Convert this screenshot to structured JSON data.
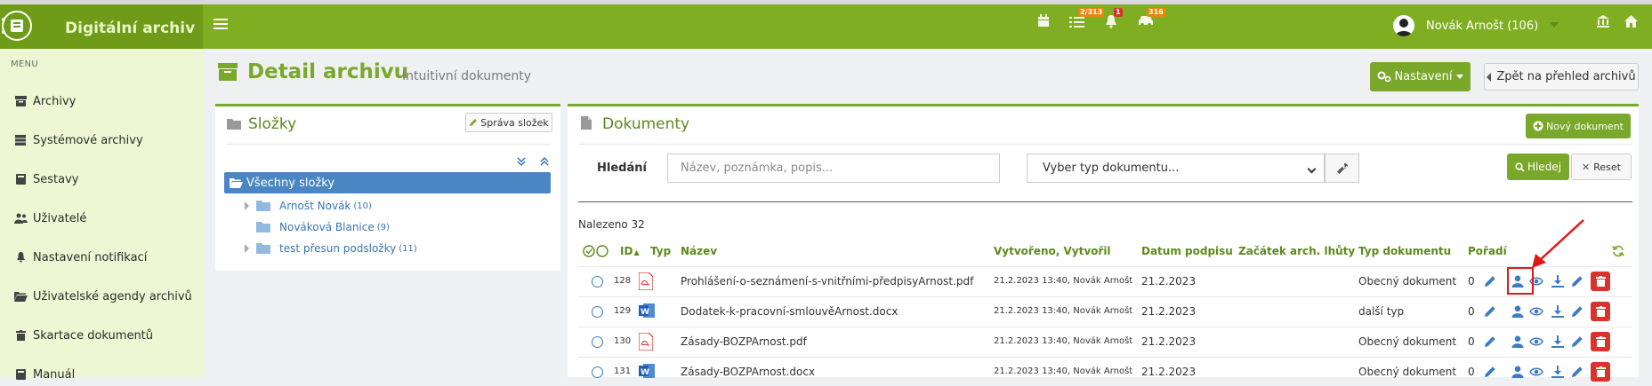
{
  "app": {
    "title": "Digitální archiv"
  },
  "topbar": {
    "badges": {
      "tasks": "2/313",
      "notifications": "1",
      "transfers": "316"
    },
    "user_name": "Novák Arnošt (106)"
  },
  "sidebar": {
    "menu_label": "MENU",
    "items": [
      {
        "label": "Archivy",
        "icon": "archive-icon"
      },
      {
        "label": "Systémové archivy",
        "icon": "server-icon"
      },
      {
        "label": "Sestavy",
        "icon": "book-icon"
      },
      {
        "label": "Uživatelé",
        "icon": "users-icon"
      },
      {
        "label": "Nastavení notifikací",
        "icon": "bell-icon"
      },
      {
        "label": "Uživatelské agendy archivů",
        "icon": "folder-open-icon"
      },
      {
        "label": "Skartace dokumentů",
        "icon": "trash-icon"
      },
      {
        "label": "Manuál",
        "icon": "book-icon"
      }
    ]
  },
  "page": {
    "title": "Detail archivu",
    "subtitle": "Intuitivní dokumenty",
    "settings_label": "Nastavení",
    "back_label": "Zpět na přehled archivů"
  },
  "folders": {
    "title": "Složky",
    "manage_label": "Správa složek",
    "root": "Všechny složky",
    "items": [
      {
        "name": "Arnošt Novák",
        "count": "(10)"
      },
      {
        "name": "Nováková Blanice",
        "count": "(9)"
      },
      {
        "name": "test přesun podsložky",
        "count": "(11)"
      }
    ]
  },
  "documents": {
    "title": "Dokumenty",
    "new_label": "Nový dokument",
    "search_label": "Hledání",
    "search_placeholder": "Název, poznámka, popis...",
    "doc_type_select": "Vyber typ dokumentu...",
    "search_button": "Hledej",
    "reset_button": "Reset",
    "found": "Nalezeno 32",
    "columns": {
      "id": "ID",
      "type": "Typ",
      "name": "Název",
      "created": "Vytvořeno, Vytvořil",
      "signed": "Datum podpisu",
      "retention": "Začátek arch. lhůty",
      "doc_type": "Typ dokumentu",
      "order": "Pořadí"
    },
    "rows": [
      {
        "id": "128",
        "file_type": "pdf",
        "name": "Prohlášení-o-seznámení-s-vnitřními-předpisyArnost.pdf",
        "created": "21.2.2023 13:40, Novák Arnošt",
        "signed": "21.2.2023",
        "retention": "",
        "doc_type": "Obecný dokument",
        "order": "0"
      },
      {
        "id": "129",
        "file_type": "docx",
        "name": "Dodatek-k-pracovní-smlouvěArnost.docx",
        "created": "21.2.2023 13:40, Novák Arnošt",
        "signed": "21.2.2023",
        "retention": "",
        "doc_type": "další typ",
        "order": "0"
      },
      {
        "id": "130",
        "file_type": "pdf",
        "name": "Zásady-BOZPArnost.pdf",
        "created": "21.2.2023 13:40, Novák Arnošt",
        "signed": "21.2.2023",
        "retention": "",
        "doc_type": "Obecný dokument",
        "order": "0"
      },
      {
        "id": "131",
        "file_type": "docx",
        "name": "Zásady-BOZPArnost.docx",
        "created": "21.2.2023 13:40, Novák Arnošt",
        "signed": "21.2.2023",
        "retention": "",
        "doc_type": "Obecný dokument",
        "order": "0"
      }
    ]
  },
  "colors": {
    "brand": "#7fae23",
    "brand_dark": "#6e9c18",
    "link": "#3575b6",
    "danger": "#d9342b",
    "highlight": "#e01818"
  }
}
